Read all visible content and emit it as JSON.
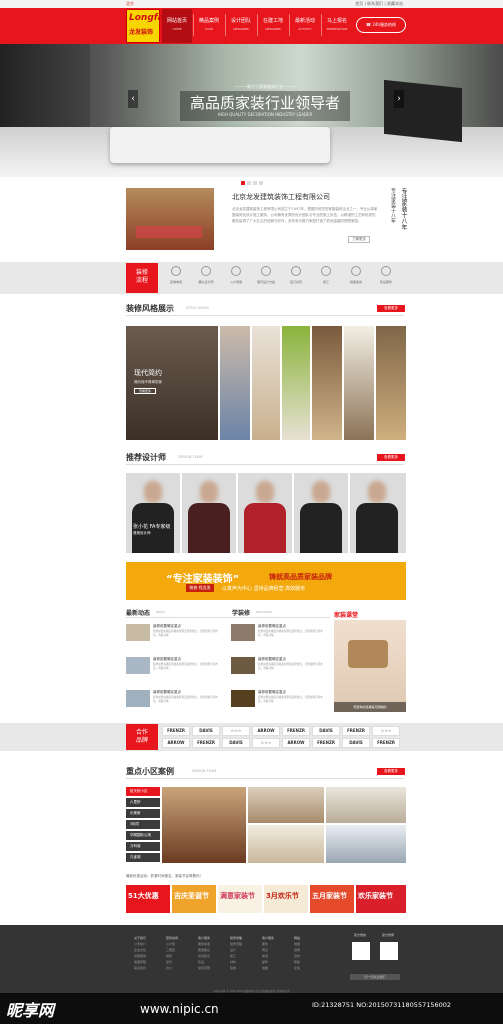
{
  "topbar": {
    "left": "北京",
    "right": "首页 | 联系我们 | 收藏本站"
  },
  "logo": {
    "en": "Longfa",
    "cn": "龙发装饰"
  },
  "nav": [
    {
      "t": "网站首页",
      "s": "HOME"
    },
    {
      "t": "精品案例",
      "s": "CASE"
    },
    {
      "t": "设计团队",
      "s": "DESIGNER"
    },
    {
      "t": "在建工地",
      "s": "DESIGNER"
    },
    {
      "t": "最新活动",
      "s": "ACTIVITY"
    },
    {
      "t": "马上报名",
      "s": "RESERVATION"
    }
  ],
  "hotline": "24h服务热线",
  "hero": {
    "kicker": "———致力于家装服务行业———",
    "title": "高品质家装行业领导者",
    "sub": "HIGH QUALITY DECORATION INDUSTRY LEADER",
    "prev": "‹",
    "next": "›"
  },
  "about": {
    "title": "北京龙发建筑装饰工程有限公司",
    "text": "北京龙发建筑装饰工程有限公司成立于1997年，是国内领先的家庭装修企业之一，专业从事家庭装修及设计施工服务。公司拥有优秀的设计团队与专业的施工队伍，以精湛的工艺和优质的服务赢得了广大业主的信赖与好评，多年来为数万家庭打造了舒适温馨的理想家园。",
    "more": "了解更多",
    "vert_a": "专注家装十八年",
    "vert_b": "专注家装十八年"
  },
  "process": {
    "label_a": "装修",
    "label_b": "流程",
    "steps": [
      "咨询电话",
      "确认设计师",
      "入户测量",
      "量尺设计方案",
      "签订合同",
      "施工",
      "验收完成",
      "售后服务"
    ]
  },
  "style_show": {
    "title": "装修风格展示",
    "en": "STYLE SHOW",
    "more": "查看更多",
    "caption": "现代简约",
    "caption_sub": "简约而不简单的家",
    "btn": "查看更多"
  },
  "designers": {
    "title": "推荐设计师",
    "en": "DESIGN TEAM",
    "more": "查看更多",
    "first_name": "张小花  FA专家级",
    "first_role": "首席设计师"
  },
  "banner": {
    "headline": "“专注家装装饰”",
    "headline_b": "铸就高品质家装品牌",
    "tag": "装修 找龙发",
    "line": "以真声为中心  坚持品牌经营  高效服务"
  },
  "news": {
    "left_title": "最新动态",
    "left_en": "NEWS",
    "right_title": "学装修",
    "right_en": "DECORATE",
    "items": [
      {
        "t": "装修前要确定重点",
        "x": "装修前要先确定风格和预算及装修重点，合理规划空间布局。查看详情"
      },
      {
        "t": "装修前要确定重点",
        "x": "装修前要先确定风格和预算及装修重点，合理规划空间布局。查看详情"
      },
      {
        "t": "装修前要确定重点",
        "x": "装修前要先确定风格和预算及装修重点，合理规划空间布局。查看详情"
      },
      {
        "t": "装修前要确定重点",
        "x": "装修前要先确定风格和预算及装修重点，合理规划空间布局。查看详情"
      },
      {
        "t": "装修前要确定重点",
        "x": "装修前要先确定风格和预算及装修重点，合理规划空间布局。查看详情"
      },
      {
        "t": "装修前要确定重点",
        "x": "装修前要先确定风格和预算及装修重点，合理规划空间布局。查看详情"
      }
    ],
    "promo_head": "家装课堂",
    "promo_foot": "家装你的选择是无限制的"
  },
  "partners": {
    "label_a": "合作",
    "label_b": "品牌",
    "logos": [
      "FRENZR",
      "DAVIS",
      "☆☆☆",
      "ARROW",
      "FRENZR",
      "DAVIS",
      "FRENZR",
      "☆☆☆",
      "ARROW",
      "FRENZR",
      "DAVIS",
      "☆☆☆",
      "ARROW",
      "FRENZR",
      "DAVIS",
      "FRENZR"
    ]
  },
  "cases": {
    "title": "重点小区案例",
    "en": "DESIGN TEAM",
    "more": "查看更多",
    "tabs": [
      "航天桥小区",
      "六里桥",
      "乐美家",
      "3街坊",
      "华顺国际公寓",
      "万科城",
      "孔雀城"
    ]
  },
  "ads": {
    "intro": "最新优惠活动：抓紧时间报名，家装节会等着你！",
    "items": [
      "51大优惠",
      "吉庆圣诞节",
      "满意家装节",
      "3月欢乐节",
      "五月家装节",
      "欢乐家装节"
    ]
  },
  "footer": {
    "cols": [
      {
        "h": "关于我们",
        "items": [
          "公司简介",
          "企业文化",
          "资质荣誉",
          "发展历程",
          "联系我们"
        ]
      },
      {
        "h": "装修案例",
        "items": [
          "小户型",
          "三居室",
          "别墅",
          "复式",
          "办公"
        ]
      },
      {
        "h": "客户服务",
        "items": [
          "服务承诺",
          "质量保证",
          "投诉建议",
          "售后",
          "常见问题"
        ]
      },
      {
        "h": "装修攻略",
        "items": [
          "装修流程",
          "设计",
          "施工",
          "材料",
          "验收"
        ]
      },
      {
        "h": "客户服务",
        "items": [
          "服务",
          "网点",
          "电话",
          "邮件",
          "地图"
        ]
      },
      {
        "h": "网站",
        "items": [
          "地图",
          "招聘",
          "合作",
          "帮助",
          "反馈"
        ]
      }
    ],
    "qr1": "官方微信",
    "qr2": "官方微博",
    "btn": "扫一扫关注我们",
    "copy": "Copyright © 2015-2016 版权所有 北京龙发建筑装饰工程有限公司"
  },
  "watermark": {
    "brand": "昵享网",
    "url": "www.nipic.cn",
    "id": "ID:21328751 NO:20150731180557156002"
  },
  "colors": {
    "accent": "#e7161d",
    "banner": "#f3a90c"
  }
}
